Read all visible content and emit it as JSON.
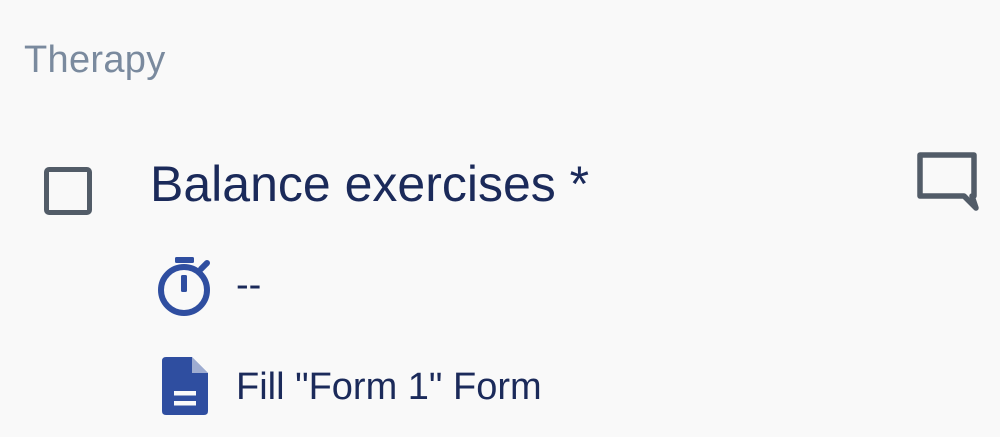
{
  "section": {
    "title": "Therapy"
  },
  "task": {
    "title": "Balance exercises *",
    "checked": false,
    "duration": "--",
    "form_label": "Fill \"Form 1\" Form"
  },
  "colors": {
    "background": "#f9f9f9",
    "section_header": "#7a8a9e",
    "text_primary": "#1b2a5a",
    "icon_gray": "#525c68",
    "icon_blue": "#2f4ea0"
  },
  "icons": {
    "comment": "comment-icon",
    "timer": "timer-icon",
    "form": "form-document-icon"
  }
}
